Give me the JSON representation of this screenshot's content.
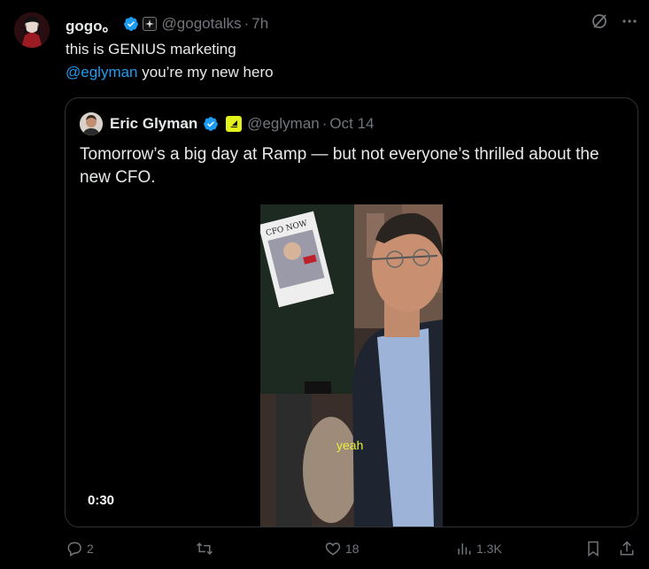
{
  "tweet": {
    "author_name": "gogo。",
    "handle": "@gogotalks",
    "time": "7h",
    "line1": "this is GENIUS marketing",
    "mention": "@eglyman",
    "line2_rest": " you’re my new hero"
  },
  "quote": {
    "author_name": "Eric Glyman",
    "handle": "@eglyman",
    "date": "Oct 14",
    "text": "Tomorrow’s a big day at Ramp — but not everyone’s thrilled about the new CFO.",
    "video": {
      "caption": "yeah",
      "timer": "0:30",
      "poster_text": "CFO NOW"
    }
  },
  "actions": {
    "replies": "2",
    "reposts": "",
    "likes": "18",
    "views": "1.3K"
  },
  "colors": {
    "accent": "#1d9bf0",
    "muted": "#71767b",
    "border": "#2f3336",
    "badge_yellow": "#e4f21b"
  }
}
